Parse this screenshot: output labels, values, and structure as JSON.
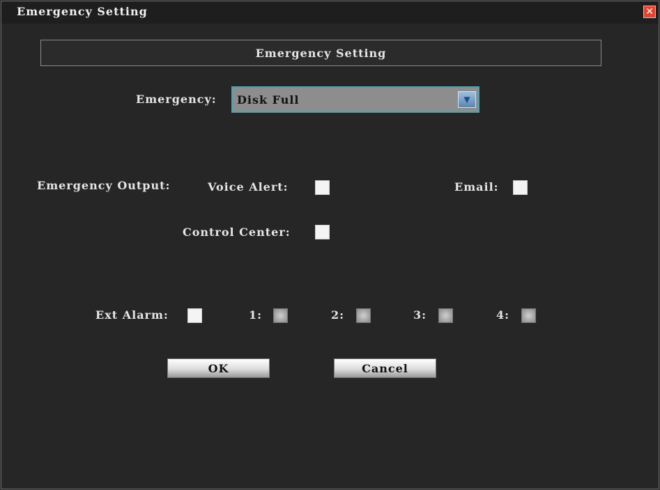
{
  "window": {
    "title": "Emergency Setting",
    "close_icon": "close-icon"
  },
  "section": {
    "header": "Emergency Setting"
  },
  "emergency": {
    "label": "Emergency:",
    "value": "Disk Full",
    "dropdown_icon": "chevron-down-icon"
  },
  "output": {
    "label": "Emergency Output:",
    "voice_alert": {
      "label": "Voice Alert:",
      "checked": false
    },
    "email": {
      "label": "Email:",
      "checked": false
    },
    "control_center": {
      "label": "Control Center:",
      "checked": false
    }
  },
  "ext_alarm": {
    "label": "Ext Alarm:",
    "checked": false,
    "channels": [
      {
        "label": "1:",
        "enabled": false
      },
      {
        "label": "2:",
        "enabled": false
      },
      {
        "label": "3:",
        "enabled": false
      },
      {
        "label": "4:",
        "enabled": false
      }
    ]
  },
  "buttons": {
    "ok": "OK",
    "cancel": "Cancel"
  },
  "colors": {
    "accent": "#4da3b0",
    "close": "#e2442f",
    "background": "#262626"
  }
}
